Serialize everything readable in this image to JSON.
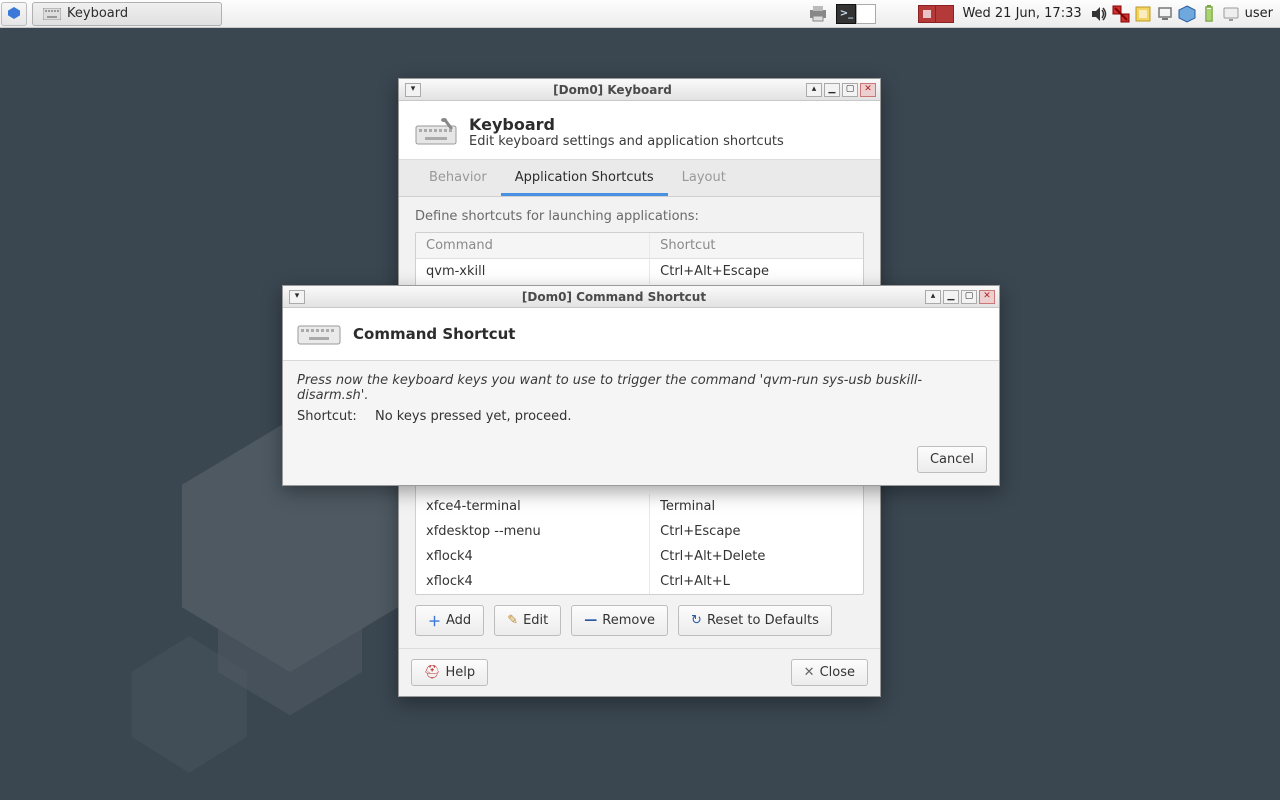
{
  "panel": {
    "taskbar_item_label": "Keyboard",
    "clock": "Wed 21 Jun, 17:33",
    "username": "user"
  },
  "keyboard_window": {
    "title": "[Dom0] Keyboard",
    "header_title": "Keyboard",
    "header_subtitle": "Edit keyboard settings and application shortcuts",
    "tabs": {
      "behavior": "Behavior",
      "shortcuts": "Application Shortcuts",
      "layout": "Layout"
    },
    "hint": "Define shortcuts for launching applications:",
    "columns": {
      "command": "Command",
      "shortcut": "Shortcut"
    },
    "rows": [
      {
        "cmd": "qvm-xkill",
        "sc": "Ctrl+Alt+Escape"
      },
      {
        "cmd": "xfce4-terminal",
        "sc": "Terminal"
      },
      {
        "cmd": "xfdesktop --menu",
        "sc": "Ctrl+Escape"
      },
      {
        "cmd": "xflock4",
        "sc": "Ctrl+Alt+Delete"
      },
      {
        "cmd": "xflock4",
        "sc": "Ctrl+Alt+L"
      }
    ],
    "buttons": {
      "add": "Add",
      "edit": "Edit",
      "remove": "Remove",
      "reset": "Reset to Defaults",
      "help": "Help",
      "close": "Close"
    }
  },
  "command_dialog": {
    "title": "[Dom0] Command Shortcut",
    "header": "Command Shortcut",
    "instruction": "Press now the keyboard keys you want to use to trigger the command 'qvm-run sys-usb buskill-disarm.sh'.",
    "shortcut_label": "Shortcut:",
    "shortcut_value": "No keys pressed yet, proceed.",
    "cancel": "Cancel"
  }
}
